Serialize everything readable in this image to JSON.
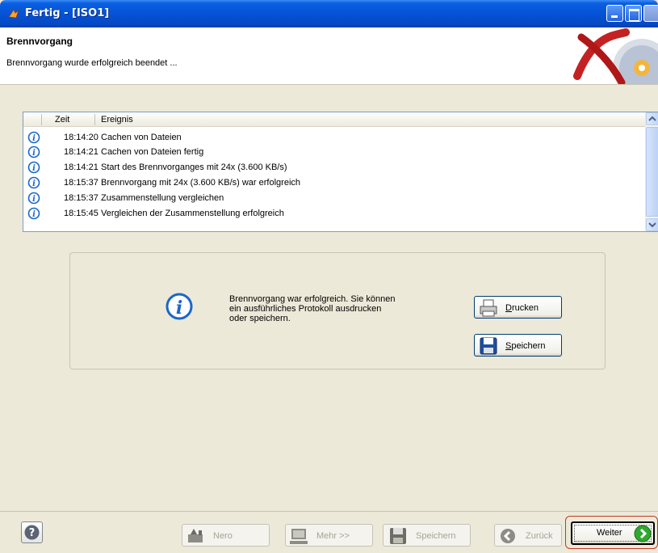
{
  "window": {
    "title": "Fertig - [ISO1]"
  },
  "header": {
    "title": "Brennvorgang",
    "subtitle": "Brennvorgang wurde erfolgreich beendet ..."
  },
  "log": {
    "columns": [
      "Zeit",
      "Ereignis"
    ],
    "rows": [
      {
        "time": "18:14:20",
        "event": "Cachen von Dateien"
      },
      {
        "time": "18:14:21",
        "event": "Cachen von Dateien fertig"
      },
      {
        "time": "18:14:21",
        "event": "Start des Brennvorganges mit 24x (3.600 KB/s)"
      },
      {
        "time": "18:15:37",
        "event": "Brennvorgang  mit 24x (3.600 KB/s) war erfolgreich"
      },
      {
        "time": "18:15:37",
        "event": "Zusammenstellung vergleichen"
      },
      {
        "time": "18:15:45",
        "event": "Vergleichen der Zusammenstellung erfolgreich"
      }
    ]
  },
  "info": {
    "message": "Brennvorgang war erfolgreich. Sie können ein ausführliches Protokoll ausdrucken oder speichern.",
    "print_first": "D",
    "print_rest": "rucken",
    "save_first": "S",
    "save_rest": "peichern"
  },
  "footer": {
    "nero": "Nero",
    "more": "Mehr >>",
    "save": "Speichern",
    "back": "Zurück",
    "next": "Weiter"
  },
  "colors": {
    "titlebar": "#0553d6",
    "accent_ring": "#c0392b",
    "go_green": "#2fa82f",
    "info_blue": "#1a66cc"
  }
}
